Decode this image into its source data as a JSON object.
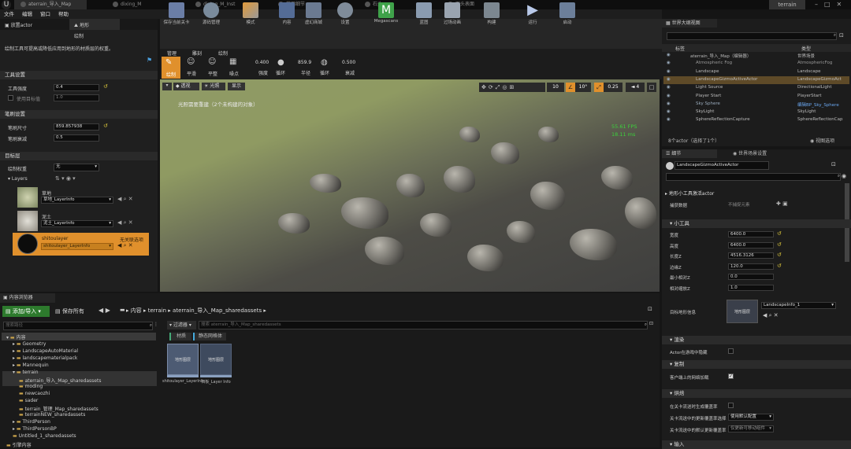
{
  "titlebar": {
    "tabs": [
      "aterrain_导入_Map",
      "dixing_M",
      "dixing_M_Inst",
      "草面细节",
      "石头",
      "石头表面"
    ],
    "project": "terrain"
  },
  "menu": [
    "文件",
    "编辑",
    "窗口",
    "帮助"
  ],
  "modes": {
    "tab1": "放置actor",
    "tab2": "地形",
    "sub": "绘制",
    "desc": "绘制工具可提高或降低应用到地形的材质层的权重。"
  },
  "tool_settings": {
    "title": "工具设置",
    "strength_label": "工具强度",
    "strength": "0.4",
    "target_label": "使用目标值",
    "target": "1.0"
  },
  "brush_settings": {
    "title": "笔刷设置",
    "size_label": "笔刷尺寸",
    "size": "859.857938",
    "falloff_label": "笔刷衰减",
    "falloff": "0.5"
  },
  "target_layers": {
    "title": "目标层",
    "paint_layer_label": "绘制权重",
    "paint_layer": "无",
    "layers_label": "Layers",
    "layers": [
      {
        "name": "草地",
        "info": "草地_LayerInfo"
      },
      {
        "name": "泥土",
        "info": "泥土_LayerInfo"
      },
      {
        "name": "shitoulayer",
        "info": "shitoulayer_LayerInfo",
        "note": "无关联选项"
      }
    ]
  },
  "toolbar": [
    "保存当前关卡",
    "源码管理",
    "模式",
    "内容",
    "虚幻商城",
    "设置",
    "Megascans",
    "蓝图",
    "过场动画",
    "构建",
    "运行",
    "启动"
  ],
  "landscape_tabs": [
    "管理",
    "雕刻",
    "绘制"
  ],
  "paint_tools": [
    "绘制",
    "平滑",
    "平整",
    "噪点"
  ],
  "brush_stats": [
    {
      "v": "0.400",
      "l": "强度"
    },
    {
      "v": "859.9",
      "l": "半径"
    },
    {
      "v": "0.500",
      "l": "衰减"
    }
  ],
  "brush_type": "循环",
  "viewport": {
    "perspective": "透视",
    "lit": "光照",
    "show": "显示",
    "hint": "光照需要重建（2个未构建的对象）",
    "stats_fps": "55.61 FPS",
    "stats_ms": "18.11 ms",
    "snap": [
      "10",
      "10°",
      "0.25",
      "4"
    ]
  },
  "content_browser": {
    "title": "内容浏览器",
    "add": "添加/导入",
    "save_all": "保存所有",
    "crumbs": [
      "内容",
      "terrain",
      "aterrain_导入_Map_sharedassets"
    ],
    "search_paths": "搜索路径",
    "filters": "过滤器",
    "search_asset": "搜索 aterrain_导入_Map_sharedassets",
    "filter_tags": [
      "材质",
      "静态网格体"
    ],
    "tree": [
      "内容",
      "Geometry",
      "LandscapeAutoMaterial",
      "landscapematerialpack",
      "Mannequin",
      "terrain",
      "aterrain_导入_Map_sharedassets",
      "moding",
      "newcaozhi",
      "sader",
      "terrain_管理_Map_sharedassets",
      "terrainNEW_sharedassets",
      "ThirdPerson",
      "ThirdPersonBP",
      "Untitled_1_sharedassets",
      "引擎内容"
    ],
    "assets": [
      {
        "name": "shitoulayer_LayerInfo",
        "thumb": "地形图层"
      },
      {
        "name": "石板_Layer Info",
        "thumb": "地形图层"
      }
    ]
  },
  "outliner": {
    "title": "世界大纲视图",
    "col_label": "标签",
    "col_type": "类型",
    "rows": [
      {
        "label": "aterrain_导入_Map（编辑器）",
        "type": "世界场景"
      },
      {
        "label": "Atmospheric Fog",
        "type": "AtmosphericFog"
      },
      {
        "label": "Landscape",
        "type": "Landscape"
      },
      {
        "label": "LandscapeGizmoActiveActor",
        "type": "LandscapeGizmoAct"
      },
      {
        "label": "Light Source",
        "type": "DirectionalLight"
      },
      {
        "label": "Player Start",
        "type": "PlayerStart"
      },
      {
        "label": "Sky Sphere",
        "type": "编辑BP_Sky_Sphere"
      },
      {
        "label": "SkyLight",
        "type": "SkyLight"
      },
      {
        "label": "SphereReflectionCapture",
        "type": "SphereReflectionCap"
      }
    ],
    "count": "8个actor（选择了1个）",
    "view_options": "视图选项"
  },
  "details": {
    "tab1": "细节",
    "tab2": "世界场景设置",
    "actor": "LandscapeGizmoActiveActor",
    "component": "地形小工具激活actor",
    "snap": "捕获数据",
    "snap_val": "不捕捉元素",
    "gizmo_section": "小工具",
    "props": [
      {
        "l": "宽度",
        "v": "6400.0"
      },
      {
        "l": "高度",
        "v": "6400.0"
      },
      {
        "l": "长度Z",
        "v": "4516.3126"
      },
      {
        "l": "边缘Z",
        "v": "120.0"
      },
      {
        "l": "最小相对Z",
        "v": "0.0"
      },
      {
        "l": "相对缩放Z",
        "v": "1.0"
      }
    ],
    "target_layer_label": "目标地形信息",
    "target_layer": "LandscapeInfo_1",
    "thumb": "地形图层",
    "render": "渲染",
    "hide_in_game": "Actor在游戏中隐藏",
    "replicate": "复制",
    "net_load": "客户端上的网络加载",
    "cook": "烘焙",
    "hlod1": "在关卡流送时生成覆盖率",
    "hlod2": "关卡流送中的更新覆盖率选择",
    "hlod2_val": "使用默认配置",
    "hlod3": "关卡流送中的默认更新覆盖率",
    "hlod3_val": "仅更新可移动组件",
    "input": "输入"
  }
}
